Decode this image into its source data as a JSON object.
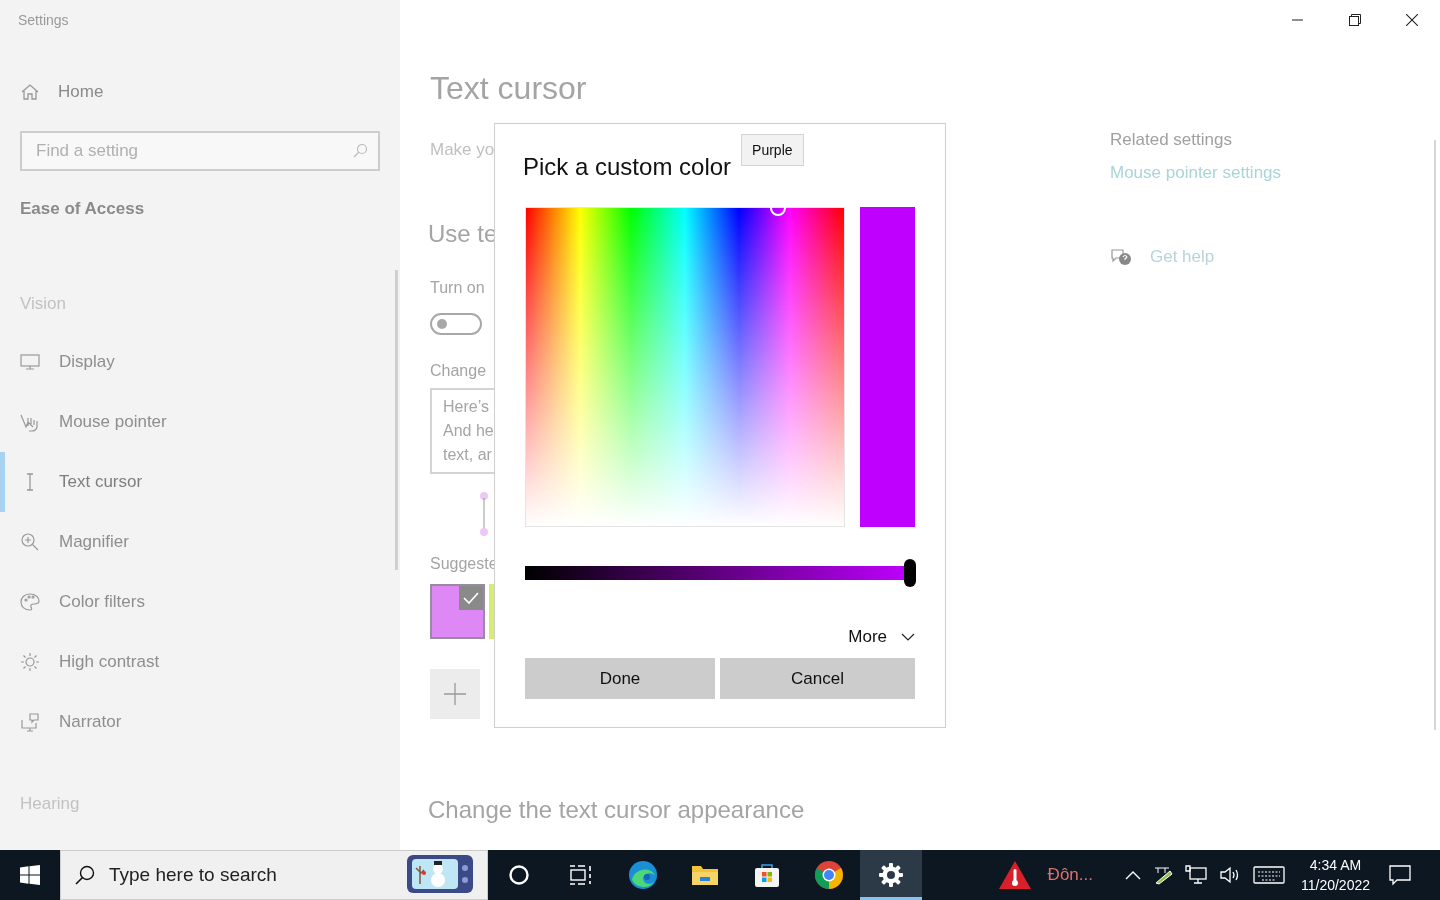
{
  "window": {
    "title": "Settings"
  },
  "sidebar": {
    "home": "Home",
    "search": {
      "placeholder": "Find a setting"
    },
    "section": "Ease of Access",
    "groups": [
      {
        "heading": "Vision",
        "items": [
          {
            "label": "Display",
            "selected": false
          },
          {
            "label": "Mouse pointer",
            "selected": false
          },
          {
            "label": "Text cursor",
            "selected": true
          },
          {
            "label": "Magnifier",
            "selected": false
          },
          {
            "label": "Color filters",
            "selected": false
          },
          {
            "label": "High contrast",
            "selected": false
          },
          {
            "label": "Narrator",
            "selected": false
          }
        ]
      },
      {
        "heading": "Hearing"
      }
    ]
  },
  "main": {
    "title": "Text cursor",
    "intro": "Make yo",
    "section": "Use te",
    "toggle": {
      "label": "Turn on",
      "on": false
    },
    "change_label": "Change",
    "preview_lines": [
      "Here’s",
      "And he",
      "text, ar"
    ],
    "suggested_label": "Suggeste",
    "swatches": [
      {
        "color": "#dd88f5",
        "selected": true
      },
      {
        "color": "#d6ee6e",
        "selected": false
      }
    ],
    "appearance_heading": "Change the text cursor appearance"
  },
  "related": {
    "heading": "Related settings",
    "link": "Mouse pointer settings",
    "help": "Get help"
  },
  "dialog": {
    "title": "Pick a custom color",
    "tooltip": "Purple",
    "color": "#bf00ff",
    "value_slider": {
      "level": 1
    },
    "more": "More",
    "buttons": [
      "Done",
      "Cancel"
    ]
  },
  "taskbar": {
    "search": {
      "placeholder": "Type here to search"
    },
    "apps": [
      {
        "kind": "cortana",
        "selected": false
      },
      {
        "kind": "taskview",
        "selected": false
      },
      {
        "kind": "edge",
        "selected": false
      },
      {
        "kind": "explorer",
        "selected": false
      },
      {
        "kind": "store",
        "selected": false
      },
      {
        "kind": "chrome",
        "selected": false
      },
      {
        "kind": "settings",
        "selected": true
      }
    ],
    "weather": "Đôn...",
    "time": "4:34 AM",
    "date": "11/20/2022"
  }
}
